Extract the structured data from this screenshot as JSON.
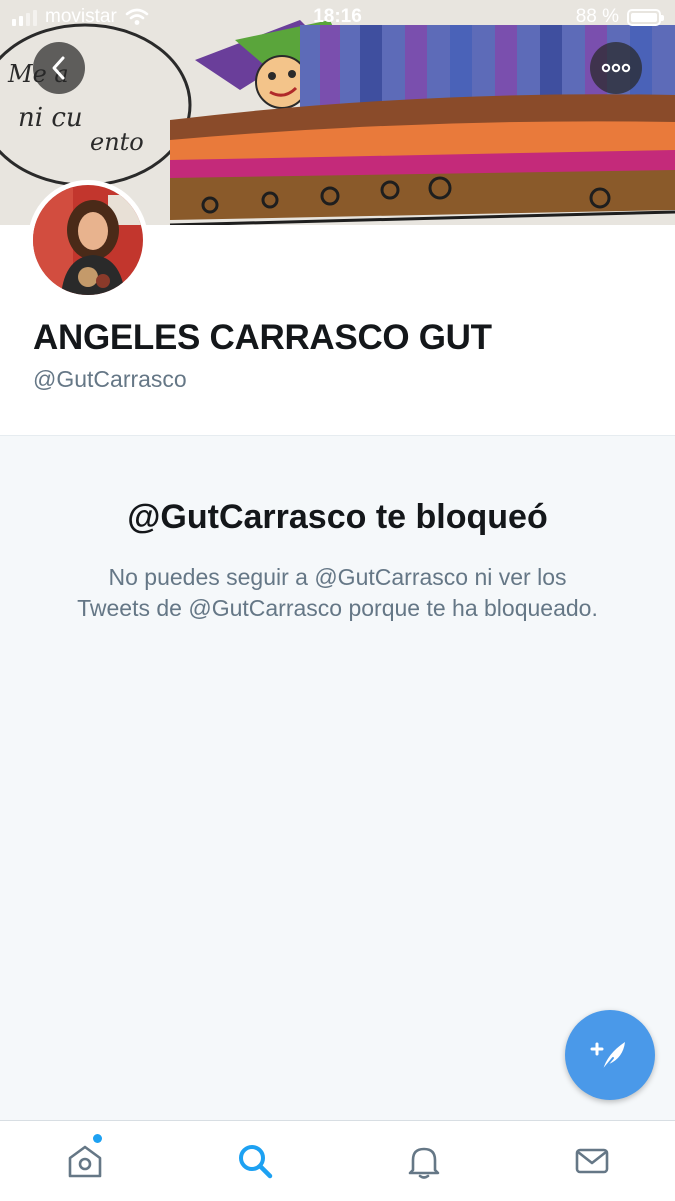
{
  "status_bar": {
    "carrier": "movistar",
    "time": "18:16",
    "battery": "88 %"
  },
  "banner": {
    "art_text": [
      "Me a",
      "ni cu",
      "ento"
    ]
  },
  "profile": {
    "display_name": "ANGELES CARRASCO GUT",
    "handle": "@GutCarrasco"
  },
  "blocked": {
    "title": "@GutCarrasco te bloqueó",
    "message": "No puedes seguir a @GutCarrasco ni ver los Tweets de @GutCarrasco porque te ha bloqueado."
  },
  "actions": {
    "back_icon": "chevron-left-icon",
    "more_icon": "more-horizontal-icon",
    "compose_icon": "compose-tweet-icon"
  },
  "tabbar": {
    "items": [
      {
        "icon": "home-icon",
        "selected": false,
        "has_badge": true
      },
      {
        "icon": "search-icon",
        "selected": true,
        "has_badge": false
      },
      {
        "icon": "bell-icon",
        "selected": false,
        "has_badge": false
      },
      {
        "icon": "mail-icon",
        "selected": false,
        "has_badge": false
      }
    ]
  },
  "colors": {
    "accent": "#1da1f2",
    "fab": "#4a99e9",
    "text_primary": "#14171a",
    "text_secondary": "#657786",
    "panel_bg": "#f5f8fa",
    "tab_icon": "#657786"
  }
}
